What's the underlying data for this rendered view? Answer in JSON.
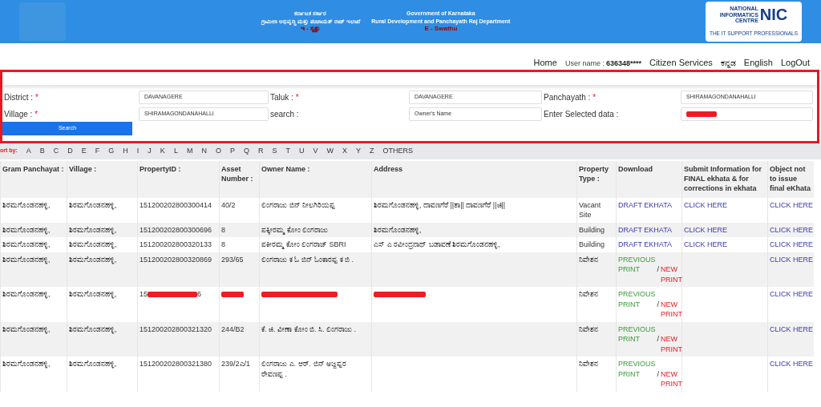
{
  "header": {
    "kannada_lines": [
      "ಕರ್ನಾಟಕ ಸರ್ಕಾರ",
      "ಗ್ರಾಮೀಣ ಅಭಿವೃದ್ಧಿ ಮತ್ತು ಪಂಚಾಯತ್ ರಾಜ್ ಇಲಾಖೆ"
    ],
    "kannada_app": "ಇ - ಸ್ವತ್ತು",
    "english_lines": [
      "Government of Karnataka",
      "Rural Development and Panchayath Raj Department"
    ],
    "english_app": "E - Swathu",
    "nic_text": [
      "NATIONAL",
      "INFORMATICS",
      "CENTRE"
    ],
    "nic_short": "NIC",
    "nic_tagline": "THE IT SUPPORT PROFESSIONALS"
  },
  "nav": {
    "home": "Home",
    "user_label": "User name :",
    "user_value": "636348****",
    "citizen_services": "Citizen Services",
    "kannada": "ಕನ್ನಡ",
    "english": "English",
    "logout": "LogOut"
  },
  "form": {
    "fields": [
      {
        "label": "District :",
        "required_mark": "*",
        "value": "DAVANAGERE"
      },
      {
        "label": "Taluk :",
        "required_mark": "*",
        "value": "DAVANAGERE"
      },
      {
        "label": "Panchayath :",
        "required_mark": "*",
        "value": "SHIRAMAGONDANAHALLI"
      },
      {
        "label": "Village :",
        "required_mark": "*",
        "value": "SHIRAMAGONDANAHALLI"
      },
      {
        "label": "search :",
        "value": "Owner's Name"
      },
      {
        "label": "Enter Selected data :",
        "redacted": true
      }
    ],
    "button": "Search"
  },
  "sort": {
    "label": "ort by:",
    "letters": [
      "A",
      "B",
      "C",
      "D",
      "E",
      "F",
      "G",
      "H",
      "I",
      "J",
      "K",
      "L",
      "M",
      "N",
      "O",
      "P",
      "Q",
      "R",
      "S",
      "T",
      "U",
      "V",
      "W",
      "X",
      "Y",
      "Z",
      "OTHERS"
    ]
  },
  "table": {
    "columns": [
      "Gram Panchayat :",
      "Village :",
      "PropertyID :",
      "Asset Number :",
      "Owner Name :",
      "Address",
      "Property Type :",
      "Download",
      "Submit Information for FINAL ekhata & for corrections in ekhata",
      "Object not to issue final eKhata"
    ],
    "rows": [
      {
        "gram_panchayat": "ಶಿರಮಗೊಂಡನಹಳ್ಳಿ,",
        "village": "ಶಿರಮಗೊಂಡನಹಳ್ಳಿ,",
        "property_id": "151200202800300414",
        "asset_number": "40/2",
        "owner_name": "ಲಿಂಗರಾಜು ಬಿನ್ ನೀಲಗಿರಿಯಪ್ಪ",
        "address": "ಶಿರಮಗೊಂಡನಹಳ್ಳಿ, ದಾವಣಗೆರೆ ||ತಾ|| ದಾವಣಗೆರೆ ||ಜಿ||",
        "property_type": "Vacant Site",
        "download": {
          "kind": "draft",
          "text": "DRAFT EKHATA"
        },
        "submit": "CLICK HERE",
        "object": "CLICK HERE"
      },
      {
        "gram_panchayat": "ಶಿರಮಗೊಂಡನಹಳ್ಳಿ,",
        "village": "ಶಿರಮಗೊಂಡನಹಳ್ಳಿ,",
        "property_id": "151200202800300696",
        "asset_number": "8",
        "owner_name": "ಪಕ್ಕೀರಮ್ಮ ಕೋಂ ಲಿಂಗರಾಜು",
        "address": "ಶಿರಮಗೊಂಡನಹಳ್ಳಿ,",
        "property_type": "Building",
        "download": {
          "kind": "draft",
          "text": "DRAFT EKHATA"
        },
        "submit": "CLICK HERE",
        "object": "CLICK HERE"
      },
      {
        "gram_panchayat": "ಶಿರಮಗೊಂಡನಹಳ್ಳಿ,",
        "village": "ಶಿರಮಗೊಂಡನಹಳ್ಳಿ,",
        "property_id": "151200202800320133",
        "asset_number": "8",
        "owner_name": "ಪಕೀರಮ್ಮ ಕೋಂ ಲಿಂಗರಾಜ್ SBRI",
        "address": "ಎಸ್ ಎ ರವೀಂದ್ರನಾಥ್ ಬಡಾವಣೆ ಶಿರಮಗೊಂಡನಹಳ್ಳಿ,",
        "property_type": "Building",
        "download": {
          "kind": "draft",
          "text": "DRAFT EKHATA"
        },
        "submit": "CLICK HERE",
        "object": "CLICK HERE"
      },
      {
        "gram_panchayat": "ಶಿರಮಗೊಂಡನಹಳ್ಳಿ,",
        "village": "ಶಿರಮಗೊಂಡನಹಳ್ಳಿ,",
        "property_id": "151200202800320869",
        "asset_number": "293/65",
        "owner_name": "ಲಿಂಗರಾಜು ಕ ಓ ಬಿನ್ ಓಂಕಾರಪ್ಪ ಕ ಬಿ .",
        "property_type": "ನಿವೇಶನ",
        "download": {
          "kind": "print",
          "previous": "PREVIOUS PRINT",
          "separator": "/",
          "new": "NEW PRINT"
        },
        "object": "CLICK HERE"
      },
      {
        "gram_panchayat": "ಶಿರಮಗೊಂಡನಹಳ್ಳಿ,",
        "village": "ಶಿರಮಗೊಂಡನಹಳ್ಳಿ,",
        "property_id": "15",
        "property_id_tail": "6",
        "property_id_redacted": true,
        "asset_number_redacted": true,
        "owner_name_redacted": true,
        "address_redacted": true,
        "property_type": "ನಿವೇಶನ",
        "download": {
          "kind": "print",
          "previous": "PREVIOUS PRINT",
          "separator": "/",
          "new": "NEW PRINT"
        },
        "object": "CLICK HERE"
      },
      {
        "gram_panchayat": "ಶಿರಮಗೊಂಡನಹಳ್ಳಿ,",
        "village": "ಶಿರಮಗೊಂಡನಹಳ್ಳಿ,",
        "property_id": "151200202800321320",
        "asset_number": "244/B2",
        "owner_name": "ಕೆ. ಜಿ. ವೀಣಾ ಕೋಂ ಬಿ. ಸಿ. ಲಿಂಗರಾಜು .",
        "property_type": "ನಿವೇಶನ",
        "download": {
          "kind": "print",
          "previous": "PREVIOUS PRINT",
          "separator": "/",
          "new": "NEW PRINT"
        },
        "object": "CLICK HERE"
      },
      {
        "gram_panchayat": "ಶಿರಮಗೊಂಡನಹಳ್ಳಿ,",
        "village": "ಶಿರಮಗೊಂಡನಹಳ್ಳಿ,",
        "property_id": "151200202800321380",
        "asset_number": "239/2ಎ/1",
        "owner_name": "ಲಿಂಗರಾಜು ಎ. ಆರ್. ಬಿನ್ ಅಜ್ಜಪ್ಪರ ರೇವಣಪ್ಪ .",
        "property_type": "ನಿವೇಶನ",
        "download": {
          "kind": "print",
          "previous": "PREVIOUS PRINT",
          "separator": "/",
          "new": "NEW PRINT"
        },
        "object": "CLICK HERE"
      }
    ]
  }
}
